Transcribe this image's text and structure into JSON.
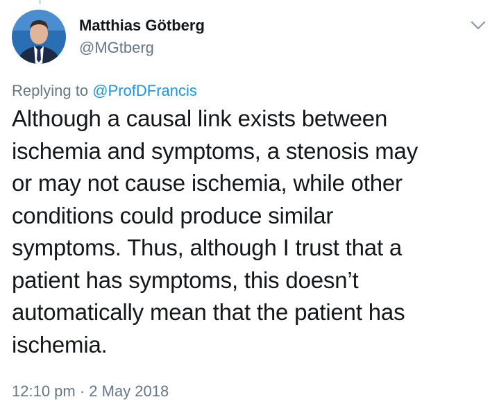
{
  "author": {
    "name": "Matthias Götberg",
    "handle": "@MGtberg",
    "avatar_icon": "profile-photo"
  },
  "reply": {
    "prefix": "Replying to ",
    "mention": "@ProfDFrancis"
  },
  "tweet": {
    "lines": [
      "Although a causal link exists between",
      "ischemia and symptoms, a stenosis may",
      "or may not cause ischemia, while other",
      "conditions could produce similar",
      "symptoms. Thus, although I trust that a",
      "patient has symptoms, this doesn’t",
      "automatically mean that the patient has",
      "ischemia."
    ]
  },
  "meta": {
    "timestamp": "12:10 pm · 2 May 2018"
  },
  "icons": {
    "menu": "chevron-down-icon"
  },
  "colors": {
    "text": "#14171a",
    "secondary": "#657786",
    "link": "#1b95e0"
  }
}
